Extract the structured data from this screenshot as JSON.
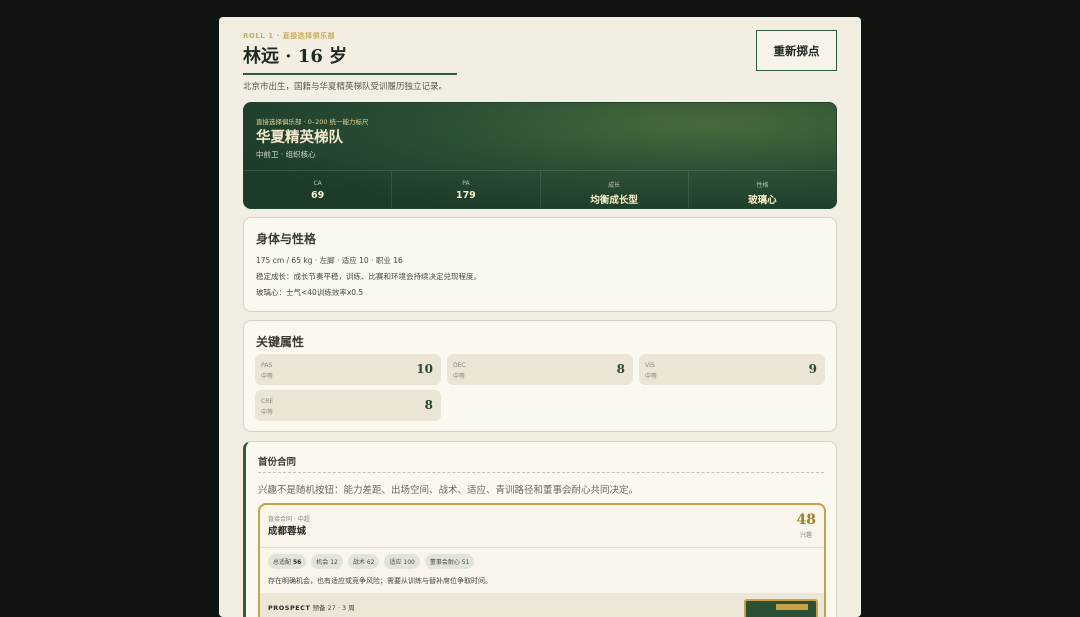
{
  "header": {
    "roll_label": "ROLL 1 · 直接选择俱乐部",
    "player_name": "林远 · 16 岁",
    "subtitle": "北京市出生，国籍与华夏精英梯队受训履历独立记录。",
    "reroll_label": "重新掷点"
  },
  "club": {
    "kicker": "直接选择俱乐部 · 0–200 统一能力标尺",
    "name": "华夏精英梯队",
    "role": "中前卫 · 组织核心",
    "stats": [
      {
        "label": "CA",
        "value": "69"
      },
      {
        "label": "PA",
        "value": "179"
      },
      {
        "label": "成长",
        "value": "均衡成长型"
      },
      {
        "label": "性格",
        "value": "玻璃心"
      }
    ]
  },
  "body": {
    "title": "身体与性格",
    "line1": "175 cm / 65 kg · 左脚 · 适应 10 · 职业 16",
    "line2": "稳定成长：成长节奏平稳，训练、比赛和环境会持续决定兑现程度。",
    "line3": "玻璃心：士气<40训练效率x0.5"
  },
  "attributes": {
    "title": "关键属性",
    "items": [
      {
        "code": "PAS",
        "grade": "中等",
        "value": "10"
      },
      {
        "code": "DEC",
        "grade": "中等",
        "value": "8"
      },
      {
        "code": "VIS",
        "grade": "中等",
        "value": "9"
      },
      {
        "code": "CRE",
        "grade": "中等",
        "value": "8"
      }
    ]
  },
  "contract": {
    "title": "首份合同",
    "desc": "兴趣不是随机按钮：能力差距、出场空间、战术、适应、青训路径和董事会耐心共同决定。",
    "offer": {
      "kicker": "直接合同 · 中超",
      "club": "成都蓉城",
      "score": "48",
      "score_label": "兴趣",
      "chips": [
        {
          "label": "总适配",
          "value": "56"
        },
        {
          "label": "机会",
          "value": "12"
        },
        {
          "label": "战术",
          "value": "62"
        },
        {
          "label": "适应",
          "value": "100"
        },
        {
          "label": "董事会耐心",
          "value": "51"
        }
      ],
      "note": "存在明确机会，也有适应或竞争风险；需要从训练与替补席位争取时间。",
      "prospect_tag": "PROSPECT",
      "prospect_text": "预备 27 · 3 周"
    }
  }
}
